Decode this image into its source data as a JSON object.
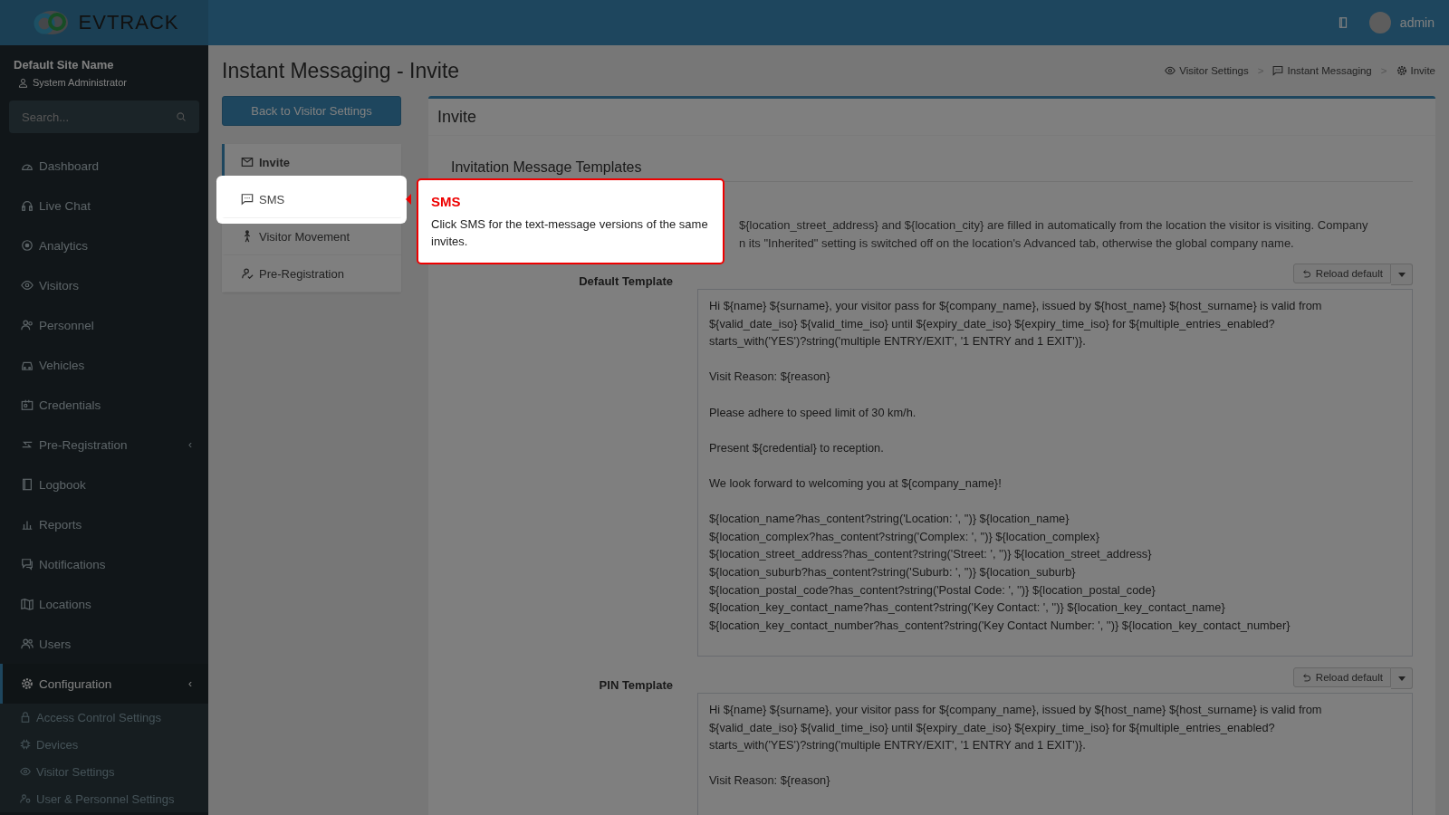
{
  "header": {
    "logo": "**EV**TRACK",
    "user": "admin"
  },
  "sidebar": {
    "site_name": "Default Site Name",
    "role": "System Administrator",
    "search_placeholder": "Search...",
    "items": [
      {
        "label": "Dashboard",
        "selected": false
      },
      {
        "label": "Live Chat",
        "selected": false
      },
      {
        "label": "Analytics",
        "selected": false
      },
      {
        "label": "Visitors",
        "selected": false
      },
      {
        "label": "Personnel",
        "selected": false
      },
      {
        "label": "Vehicles",
        "selected": false
      },
      {
        "label": "Credentials",
        "selected": false
      },
      {
        "label": "Pre-Registration",
        "selected": false,
        "chevron": "‹"
      },
      {
        "label": "Logbook",
        "selected": false
      },
      {
        "label": "Reports",
        "selected": false
      },
      {
        "label": "Notifications",
        "selected": false
      },
      {
        "label": "Locations",
        "selected": false
      },
      {
        "label": "Users",
        "selected": false
      },
      {
        "label": "Configuration",
        "selected": true,
        "chevron": "‹",
        "children": [
          {
            "label": "Access Control Settings"
          },
          {
            "label": "Devices"
          },
          {
            "label": "Visitor Settings"
          },
          {
            "label": "User & Personnel Settings"
          }
        ]
      }
    ]
  },
  "page": {
    "title": "Instant Messaging - Invite",
    "breadcrumbs": [
      {
        "label": "Visitor Settings",
        "separator": ">"
      },
      {
        "label": "Instant Messaging",
        "separator": ">"
      },
      {
        "label": "Invite"
      }
    ],
    "back_button": "Back to Visitor Settings",
    "tabs": [
      {
        "label": "Invite",
        "selected": true,
        "highlighted": false
      },
      {
        "label": "SMS",
        "selected": false,
        "highlighted": true
      },
      {
        "label": "Visitor Movement",
        "selected": false,
        "highlighted": false
      },
      {
        "label": "Pre-Registration",
        "selected": false,
        "highlighted": false
      }
    ]
  },
  "card": {
    "title": "Invite",
    "section_title": "Invitation Message Templates",
    "description_lines": [
      "${location_street_address} and ${location_city} are filled in automatically from the location the visitor is visiting. Company",
      "n its \"Inherited\" setting is switched off on the location's Advanced tab, otherwise the global company name."
    ],
    "templates": [
      {
        "label": "Default Template",
        "button": "Reload default",
        "paragraphs": [
          [
            "Hi ${name} ${surname}, your visitor pass for ${company_name}, issued by ${host_name} ${host_surname} is valid from",
            "${valid_date_iso} ${valid_time_iso} until ${expiry_date_iso} ${expiry_time_iso} for ${multiple_entries_enabled?",
            "starts_with('YES')?string('multiple ENTRY/EXIT', '1 ENTRY and 1 EXIT')}."
          ],
          [
            "Visit Reason: ${reason}"
          ],
          [
            "Please adhere to speed limit of 30 km/h."
          ],
          [
            "Present ${credential} to reception."
          ],
          [
            "We look forward to welcoming you at ${company_name}!"
          ],
          [
            "${location_name?has_content?string('Location: ', '')} ${location_name}",
            "${location_complex?has_content?string('Complex: ', '')} ${location_complex}",
            "${location_street_address?has_content?string('Street: ', '')} ${location_street_address}",
            "${location_suburb?has_content?string('Suburb: ', '')} ${location_suburb}",
            "${location_postal_code?has_content?string('Postal Code: ', '')} ${location_postal_code}",
            "${location_key_contact_name?has_content?string('Key Contact: ', '')} ${location_key_contact_name}",
            "${location_key_contact_number?has_content?string('Key Contact Number: ', '')} ${location_key_contact_number}"
          ]
        ]
      },
      {
        "label": "PIN Template",
        "button": "Reload default",
        "paragraphs": [
          [
            "Hi ${name} ${surname}, your visitor pass for ${company_name}, issued by ${host_name} ${host_surname} is valid from",
            "${valid_date_iso} ${valid_time_iso} until ${expiry_date_iso} ${expiry_time_iso} for ${multiple_entries_enabled?",
            "starts_with('YES')?string('multiple ENTRY/EXIT', '1 ENTRY and 1 EXIT')}."
          ],
          [
            "Visit Reason: ${reason}"
          ]
        ]
      }
    ]
  },
  "tour": {
    "title": "SMS",
    "text": "Click SMS for the text-message versions of the same invites."
  }
}
